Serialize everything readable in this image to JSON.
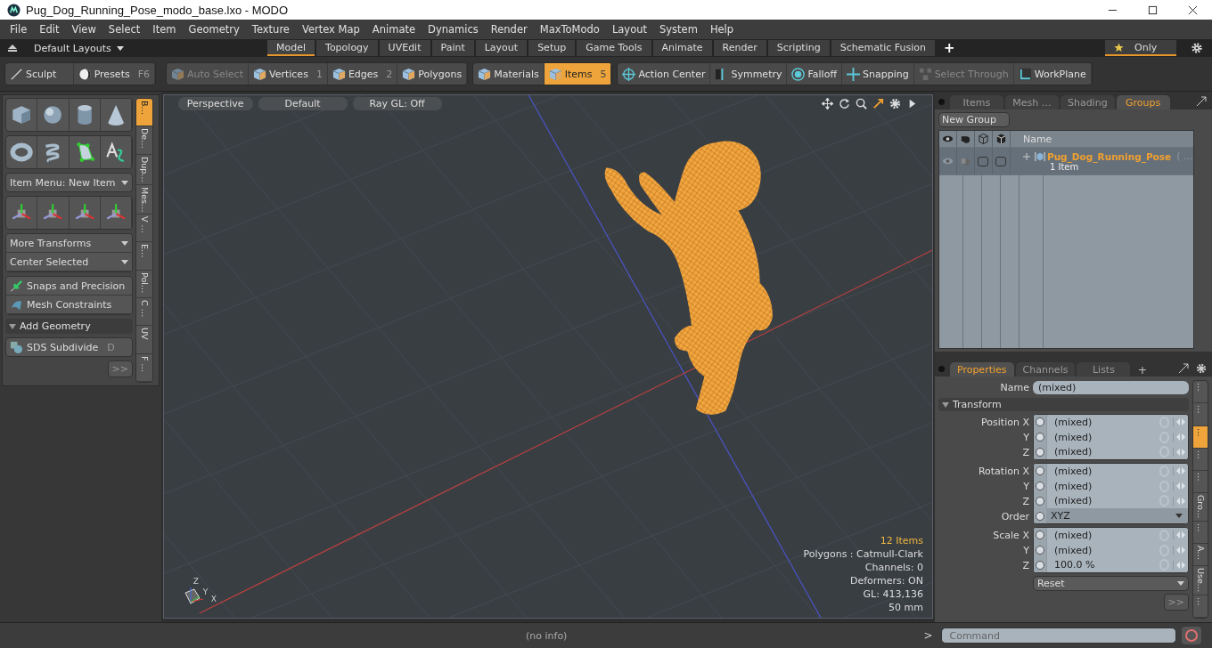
{
  "window": {
    "title": "Pug_Dog_Running_Pose_modo_base.lxo - MODO"
  },
  "menu": [
    "File",
    "Edit",
    "View",
    "Select",
    "Item",
    "Geometry",
    "Texture",
    "Vertex Map",
    "Animate",
    "Dynamics",
    "Render",
    "MaxToModo",
    "Layout",
    "System",
    "Help"
  ],
  "layout_bar": {
    "layouts": "Default Layouts",
    "tabs": [
      {
        "label": "Model",
        "selected": true
      },
      {
        "label": "Topology",
        "selected": false
      },
      {
        "label": "UVEdit",
        "selected": false
      },
      {
        "label": "Paint",
        "selected": false
      },
      {
        "label": "Layout",
        "selected": false
      },
      {
        "label": "Setup",
        "selected": false
      },
      {
        "label": "Game Tools",
        "selected": false
      },
      {
        "label": "Animate",
        "selected": false
      },
      {
        "label": "Render",
        "selected": false
      },
      {
        "label": "Scripting",
        "selected": false
      },
      {
        "label": "Schematic Fusion",
        "selected": false
      }
    ],
    "add": "+",
    "only": "Only"
  },
  "toolbar": {
    "left": [
      {
        "label": "Sculpt"
      },
      {
        "label": "Presets",
        "shortcut": "F6"
      }
    ],
    "groups": [
      [
        {
          "label": "Auto Select",
          "disabled": true,
          "selected": false,
          "kind": "cube"
        },
        {
          "label": "Vertices",
          "shortcut": "1",
          "disabled": false,
          "selected": false,
          "kind": "cube"
        },
        {
          "label": "Edges",
          "shortcut": "2",
          "disabled": false,
          "selected": false,
          "kind": "cube"
        },
        {
          "label": "Polygons",
          "disabled": false,
          "selected": false,
          "kind": "cube"
        }
      ],
      [
        {
          "label": "Materials",
          "disabled": false,
          "selected": false,
          "kind": "cube"
        },
        {
          "label": "Items",
          "shortcut": "5",
          "disabled": false,
          "selected": true,
          "kind": "cube"
        }
      ],
      [
        {
          "label": "Action Center",
          "disabled": false,
          "selected": false,
          "kind": "crosshair"
        },
        {
          "label": "Symmetry",
          "disabled": false,
          "selected": false,
          "kind": "mirror"
        },
        {
          "label": "Falloff",
          "disabled": false,
          "selected": false,
          "kind": "target"
        },
        {
          "label": "Snapping",
          "disabled": false,
          "selected": false,
          "kind": "cross"
        },
        {
          "label": "Select Through",
          "disabled": true,
          "selected": false,
          "kind": "cubes"
        },
        {
          "label": "WorkPlane",
          "disabled": false,
          "selected": false,
          "kind": "grid"
        }
      ]
    ]
  },
  "left_panel": {
    "item_menu": "Item Menu: New Item",
    "dropdowns": [
      "More Transforms",
      "Center Selected"
    ],
    "tools": [
      {
        "label": "Snaps and Precision",
        "kind": "snap"
      },
      {
        "label": "Mesh Constraints",
        "kind": "mesh"
      }
    ],
    "section": {
      "label": "Add Geometry",
      "expanded": true
    },
    "subdivide": {
      "label": "SDS Subdivide",
      "shortcut": "D"
    },
    "more": ">>",
    "side_tabs": [
      {
        "label": "B…",
        "selected": true
      },
      {
        "label": "De…",
        "selected": false
      },
      {
        "label": "Dup…",
        "selected": false
      },
      {
        "label": "Mes…",
        "selected": false
      },
      {
        "label": "V …",
        "selected": false
      },
      {
        "label": "E…",
        "selected": false
      },
      {
        "label": "Pol…",
        "selected": false
      },
      {
        "label": "C …",
        "selected": false
      },
      {
        "label": "UV",
        "selected": false
      },
      {
        "label": "F …",
        "selected": false
      }
    ]
  },
  "viewport": {
    "buttons": [
      "Perspective",
      "Default",
      "Ray GL: Off"
    ],
    "info": [
      {
        "text": "12 Items",
        "highlight": true
      },
      {
        "text": "Polygons : Catmull-Clark",
        "highlight": false
      },
      {
        "text": "Channels: 0",
        "highlight": false
      },
      {
        "text": "Deformers: ON",
        "highlight": false
      },
      {
        "text": "GL: 413,136",
        "highlight": false
      },
      {
        "text": "50 mm",
        "highlight": false
      }
    ],
    "axes": [
      "Z",
      "X",
      "Y"
    ]
  },
  "groups_panel": {
    "tabs": [
      {
        "label": "Items",
        "selected": false
      },
      {
        "label": "Mesh …",
        "selected": false
      },
      {
        "label": "Shading",
        "selected": false
      },
      {
        "label": "Groups",
        "selected": true
      }
    ],
    "new_group": "New Group",
    "column": "Name",
    "rows": [
      {
        "name": "Pug_Dog_Running_Pose",
        "suffix": "( …",
        "count": "1 Item",
        "selected": true
      }
    ]
  },
  "properties": {
    "tabs": [
      {
        "label": "Properties",
        "selected": true
      },
      {
        "label": "Channels",
        "selected": false
      },
      {
        "label": "Lists",
        "selected": false
      }
    ],
    "add": "+",
    "name_label": "Name",
    "name_value": "(mixed)",
    "section": {
      "label": "Transform",
      "expanded": true
    },
    "groups": [
      [
        {
          "label": "Position X",
          "value": "(mixed)",
          "kind": "value"
        },
        {
          "label": "Y",
          "value": "(mixed)",
          "kind": "value"
        },
        {
          "label": "Z",
          "value": "(mixed)",
          "kind": "value"
        }
      ],
      [
        {
          "label": "Rotation X",
          "value": "(mixed)",
          "kind": "value"
        },
        {
          "label": "Y",
          "value": "(mixed)",
          "kind": "value"
        },
        {
          "label": "Z",
          "value": "(mixed)",
          "kind": "value"
        },
        {
          "label": "Order",
          "value": "XYZ",
          "kind": "dropdown"
        }
      ],
      [
        {
          "label": "Scale X",
          "value": "(mixed)",
          "kind": "value"
        },
        {
          "label": "Y",
          "value": "(mixed)",
          "kind": "value"
        },
        {
          "label": "Z",
          "value": "100.0 %",
          "kind": "value"
        }
      ]
    ],
    "reset": "Reset",
    "more": ">>",
    "side_tabs": [
      {
        "label": "…",
        "selected": false
      },
      {
        "label": "…",
        "selected": false
      },
      {
        "label": "…",
        "selected": true
      },
      {
        "label": "…",
        "selected": false
      },
      {
        "label": "…",
        "selected": false
      },
      {
        "label": "Gro…",
        "selected": false
      },
      {
        "label": "…",
        "selected": false
      },
      {
        "label": "A…",
        "selected": false
      },
      {
        "label": "Use…",
        "selected": false
      },
      {
        "label": "…",
        "selected": false
      }
    ]
  },
  "status_bar": {
    "info": "(no info)",
    "prompt": ">",
    "command_placeholder": "Command"
  }
}
